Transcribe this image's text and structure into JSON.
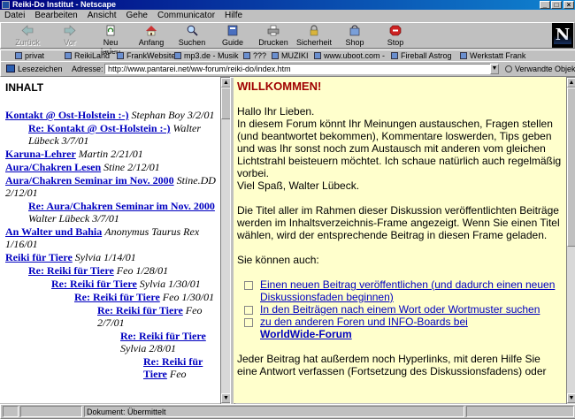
{
  "window": {
    "title": "Reiki-Do Institut - Netscape"
  },
  "menu": [
    "Datei",
    "Bearbeiten",
    "Ansicht",
    "Gehe",
    "Communicator",
    "Hilfe"
  ],
  "toolbar": [
    {
      "label": "Zurück",
      "icon": "back-arrow-icon",
      "enabled": false
    },
    {
      "label": "Vor",
      "icon": "forward-arrow-icon",
      "enabled": false
    },
    {
      "label": "Neu laden",
      "icon": "reload-icon",
      "enabled": true
    },
    {
      "label": "Anfang",
      "icon": "home-icon",
      "enabled": true
    },
    {
      "label": "Suchen",
      "icon": "search-icon",
      "enabled": true
    },
    {
      "label": "Guide",
      "icon": "guide-icon",
      "enabled": true
    },
    {
      "label": "Drucken",
      "icon": "print-icon",
      "enabled": true
    },
    {
      "label": "Sicherheit",
      "icon": "security-lock-icon",
      "enabled": true
    },
    {
      "label": "Shop",
      "icon": "shop-icon",
      "enabled": true
    },
    {
      "label": "Stop",
      "icon": "stop-icon",
      "enabled": true
    }
  ],
  "links": [
    "privat",
    "ReikiLand",
    "FrankWebsite",
    "mp3.de - Musik",
    "???",
    "MUZIKI",
    "www.uboot.com -",
    "Fireball Astrog",
    "Werkstatt Frank"
  ],
  "address": {
    "bookmarks_label": "Lesezeichen",
    "label": "Adresse:",
    "url": "http://www.pantarei.net/ww-forum/reiki-do/index.htm",
    "related": "Verwandte Objek"
  },
  "left_frame": {
    "heading": "INHALT",
    "entries": [
      {
        "title": "Kontakt @ Ost-Holstein :-)",
        "meta": "Stephan Boy 3/2/01",
        "indent": 0
      },
      {
        "title": "Re: Kontakt @ Ost-Holstein :-)",
        "meta": "Walter Lübeck 3/7/01",
        "indent": 1
      },
      {
        "title": "Karuna-Lehrer",
        "meta": "Martin 2/21/01",
        "indent": 0
      },
      {
        "title": "Aura/Chakren Lesen",
        "meta": "Stine 2/12/01",
        "indent": 0
      },
      {
        "title": "Aura/Chakren Seminar im Nov. 2000",
        "meta": "Stine.DD 2/12/01",
        "indent": 0
      },
      {
        "title": "Re: Aura/Chakren Seminar im Nov. 2000",
        "meta": "Walter Lübeck 3/7/01",
        "indent": 1
      },
      {
        "title": "An Walter und Bahia",
        "meta": "Anonymus Taurus Rex 1/16/01",
        "indent": 0
      },
      {
        "title": "Reiki für Tiere",
        "meta": "Sylvia 1/14/01",
        "indent": 0
      },
      {
        "title": "Re: Reiki für Tiere",
        "meta": "Feo 1/28/01",
        "indent": 1
      },
      {
        "title": "Re: Reiki für Tiere",
        "meta": "Sylvia 1/30/01",
        "indent": 2
      },
      {
        "title": "Re: Reiki für Tiere",
        "meta": "Feo 1/30/01",
        "indent": 3
      },
      {
        "title": "Re: Reiki für Tiere",
        "meta": "Feo 2/7/01",
        "indent": 4
      },
      {
        "title": "Re: Reiki für Tiere",
        "meta": "Sylvia 2/8/01",
        "indent": 5
      },
      {
        "title": "Re: Reiki für Tiere",
        "meta": "Feo",
        "indent": 6
      }
    ]
  },
  "right_frame": {
    "heading": "WILLKOMMEN!",
    "paragraphs": [
      "Hallo Ihr Lieben.\nIn diesem Forum könnt Ihr Meinungen austauschen, Fragen stellen (und beantwortet bekommen), Kommentare loswerden, Tips geben und was Ihr sonst noch zum Austausch mit anderen vom gleichen Lichtstrahl beisteuern möchtet. Ich schaue natürlich auch regelmäßig vorbei.\nViel Spaß, Walter Lübeck.",
      "Die Titel aller im Rahmen dieser Diskussion veröffentlichten Beiträge werden im Inhaltsverzeichnis-Frame angezeigt. Wenn Sie einen Titel wählen, wird der entsprechende Beitrag in diesen Frame geladen.",
      "Sie können auch:"
    ],
    "options": [
      {
        "text": "Einen neuen Beitrag veröffentlichen (und dadurch einen neuen Diskussionsfaden beginnen)"
      },
      {
        "text": "In den Beiträgen nach einem Wort oder Wortmuster suchen"
      },
      {
        "text": "zu den anderen Foren und INFO-Boards bei",
        "bold_link": "WorldWide-Forum"
      }
    ],
    "footer": "Jeder Beitrag hat außerdem noch Hyperlinks, mit deren Hilfe Sie eine Antwort verfassen (Fortsetzung des Diskussionsfadens) oder"
  },
  "status": {
    "text": "Dokument: Übermittelt"
  },
  "colors": {
    "title_bar": "#000080",
    "link": "#0000c0",
    "right_bg": "#ffffcc",
    "heading_red": "#a00000"
  }
}
